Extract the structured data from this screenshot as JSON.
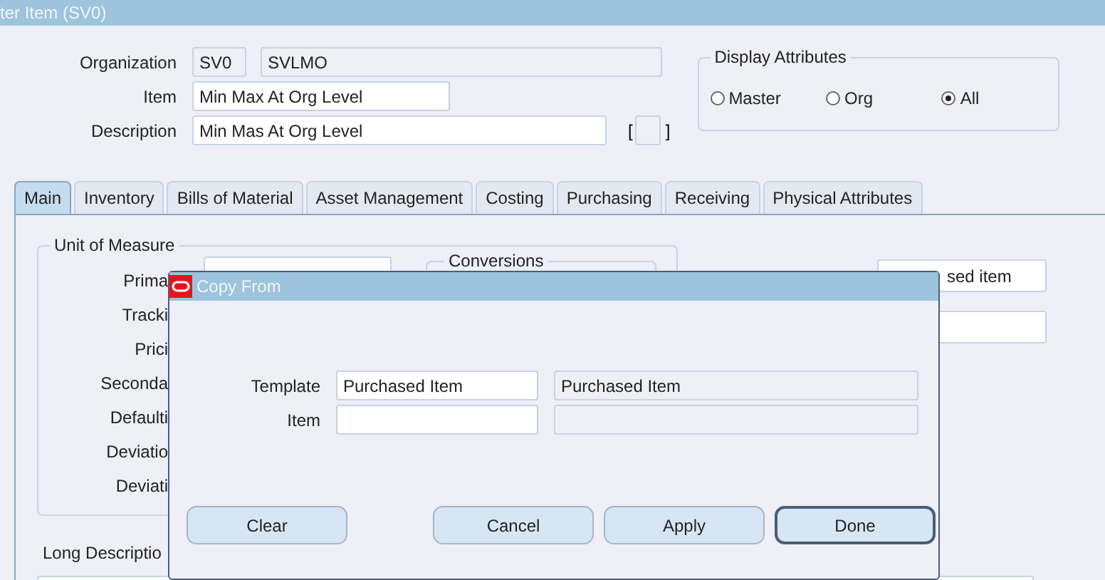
{
  "window": {
    "title": "ter Item (SV0)"
  },
  "header": {
    "fields": [
      {
        "label": "Organization",
        "kind": "pair",
        "values": [
          "SV0",
          "SVLMO"
        ]
      },
      {
        "label": "Item",
        "kind": "text",
        "values": [
          "Min Max At Org Level"
        ]
      },
      {
        "label": "Description",
        "kind": "flex",
        "values": [
          "Min Mas At Org Level"
        ],
        "bracket_open": "[",
        "bracket_close": "]"
      }
    ]
  },
  "display_attributes": {
    "title": "Display Attributes",
    "options": [
      {
        "label": "Master",
        "selected": false
      },
      {
        "label": "Org",
        "selected": false
      },
      {
        "label": "All",
        "selected": true
      }
    ]
  },
  "tabs": [
    {
      "label": "Main",
      "selected": true
    },
    {
      "label": "Inventory",
      "selected": false
    },
    {
      "label": "Bills of Material",
      "selected": false
    },
    {
      "label": "Asset Management",
      "selected": false
    },
    {
      "label": "Costing",
      "selected": false
    },
    {
      "label": "Purchasing",
      "selected": false
    },
    {
      "label": "Receiving",
      "selected": false
    },
    {
      "label": "Physical Attributes",
      "selected": false
    }
  ],
  "main": {
    "unit_of_measure": {
      "title": "Unit of Measure",
      "labels": [
        "Prima",
        "Tracki",
        "Prici",
        "Seconda",
        "Defaulti",
        "Deviatio",
        "Deviati"
      ],
      "conversions_title": "Conversions"
    },
    "right_fields": [
      {
        "kind": "filled",
        "value": "sed item"
      },
      {
        "kind": "empty"
      }
    ],
    "long_description_label": "Long Descriptio"
  },
  "dialog": {
    "title": "Copy From",
    "rows": [
      {
        "label": "Template",
        "value": "Purchased Item",
        "description": "Purchased Item"
      },
      {
        "label": "Item"
      }
    ],
    "buttons": [
      {
        "label": "Clear",
        "default": false
      },
      {
        "label": "Cancel",
        "default": false
      },
      {
        "label": "Apply",
        "default": false
      },
      {
        "label": "Done",
        "default": true
      }
    ]
  }
}
